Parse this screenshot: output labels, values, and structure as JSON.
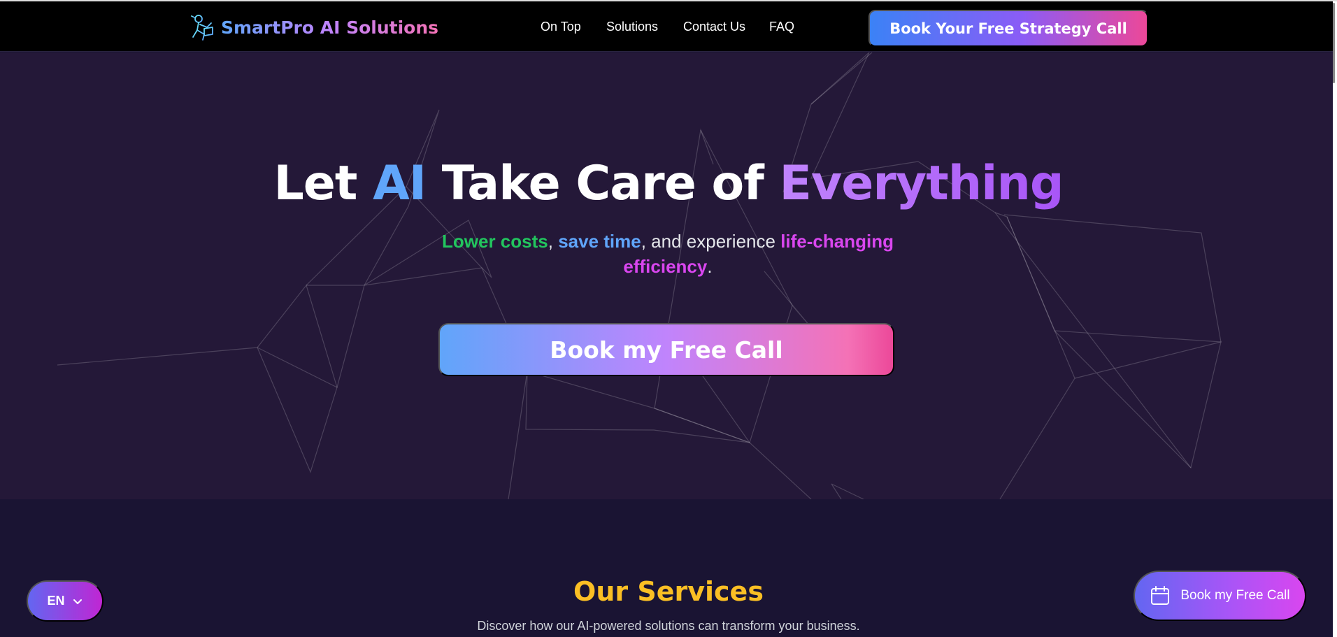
{
  "brand": {
    "name": "SmartPro AI Solutions",
    "logo_icon": "robot-reading-icon"
  },
  "nav": {
    "links": [
      "On Top",
      "Solutions",
      "Contact Us",
      "FAQ"
    ],
    "cta_label": "Book Your Free Strategy Call"
  },
  "hero": {
    "title": {
      "part1": "Let ",
      "highlight1": "AI",
      "part2": " Take Care of ",
      "highlight2": "Everything"
    },
    "subtitle": {
      "h1": "Lower costs",
      "sep1": ", ",
      "h2": "save time",
      "mid": ", and experience ",
      "h3": "life-changing efficiency",
      "end": "."
    },
    "cta_label": "Book my Free Call"
  },
  "services": {
    "title": "Our Services",
    "subtitle": "Discover how our AI-powered solutions can transform your business."
  },
  "language": {
    "selected": "EN",
    "icon": "chevron-down-icon"
  },
  "floating_cta": {
    "label": "Book my Free Call",
    "icon": "calendar-icon"
  },
  "colors": {
    "hero_bg": "#241838",
    "page_bg": "#1a1433",
    "accent_gold": "#fbbf24",
    "accent_green": "#22c55e",
    "accent_blue": "#60a5fa",
    "accent_pink": "#d946ef"
  }
}
